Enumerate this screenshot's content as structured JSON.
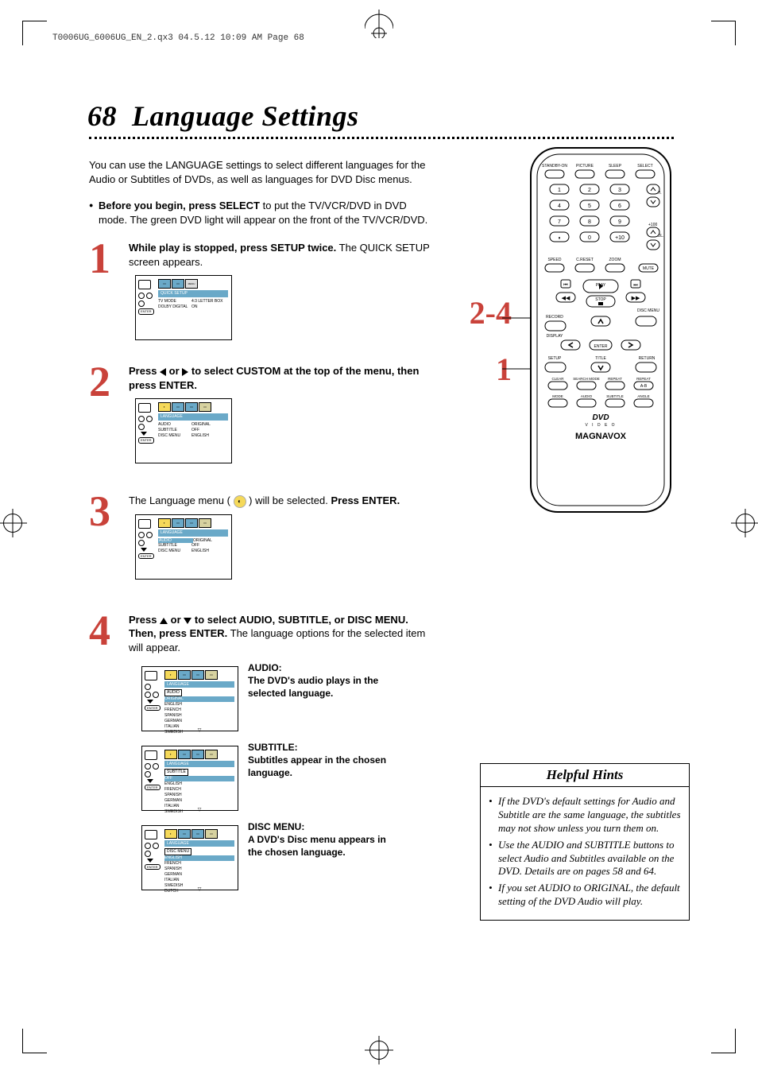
{
  "header_line": "T0006UG_6006UG_EN_2.qx3  04.5.12  10:09 AM  Page 68",
  "title_num": "68",
  "title_text": "Language Settings",
  "intro": "You can use the LANGUAGE settings to select different languages for the Audio or Subtitles of DVDs, as well as languages for DVD Disc menus.",
  "before_bold": "Before you begin, press SELECT",
  "before_rest": " to put the TV/VCR/DVD in DVD mode.  The green DVD light will appear on the front of the TV/VCR/DVD.",
  "step1_num": "1",
  "step1_bold": "While play is stopped, press SETUP twice.",
  "step1_rest": " The QUICK SETUP screen appears.",
  "step2_num": "2",
  "step2_bold": "Press ◀ or ▶ to select CUSTOM at the top of the menu, then press ENTER.",
  "step3_num": "3",
  "step3_a": "The Language menu ( ",
  "step3_b": " ) will be selected. ",
  "step3_bold": "Press ENTER.",
  "step4_num": "4",
  "step4_bold": "Press ▲ or ▼ to select AUDIO, SUBTITLE, or DISC MENU. Then, press ENTER.",
  "step4_rest": " The language options for the selected item will appear.",
  "audio_head": "AUDIO:",
  "audio_body": "The DVD's audio plays in the selected language.",
  "sub_head": "SUBTITLE:",
  "sub_body": "Subtitles appear in the chosen language.",
  "disc_head": "DISC MENU:",
  "disc_body": "A DVD's Disc menu appears in the chosen language.",
  "callout_24": "2-4",
  "callout_1": "1",
  "hints_title": "Helpful Hints",
  "hint1": "If the DVD's default settings for Audio and Subtitle are the same language, the subtitles may not show unless you turn them on.",
  "hint2": "Use the AUDIO and SUBTITLE buttons to select Audio and Subtitles available on the DVD. Details are on pages 58 and 64.",
  "hint3": "If you set AUDIO to ORIGINAL, the default setting of the DVD Audio will play.",
  "osd1_banner": "QUICK SETUP",
  "osd1_r1a": "TV MODE",
  "osd1_r1b": "4:3 LETTER BOX",
  "osd1_r2a": "DOLBY DIGITAL",
  "osd1_r2b": "ON",
  "osd_lang_banner": "LANGUAGE",
  "osd2_r1a": "AUDIO",
  "osd2_r1b": "ORIGINAL",
  "osd2_r2a": "SUBTITLE",
  "osd2_r2b": "OFF",
  "osd2_r3a": "DISC MENU",
  "osd2_r3b": "ENGLISH",
  "osd4a_head": "AUDIO",
  "osd4a_items": [
    "ORIGINAL",
    "ENGLISH",
    "FRENCH",
    "SPANISH",
    "GERMAN",
    "ITALIAN",
    "SWEDISH"
  ],
  "osd4b_head": "SUBTITLE",
  "osd4b_items": [
    "OFF",
    "ENGLISH",
    "FRENCH",
    "SPANISH",
    "GERMAN",
    "ITALIAN",
    "SWEDISH"
  ],
  "osd4c_head": "DISC MENU",
  "osd4c_items": [
    "ENGLISH",
    "FRENCH",
    "SPANISH",
    "GERMAN",
    "ITALIAN",
    "SWEDISH",
    "DUTCH"
  ],
  "enter_label": "ENTER",
  "remote": {
    "row1": [
      "STANDBY-ON",
      "PICTURE",
      "SLEEP",
      "SELECT"
    ],
    "numpad": [
      "1",
      "2",
      "3",
      "4",
      "5",
      "6",
      "7",
      "8",
      "9",
      "",
      "0",
      "+10"
    ],
    "ch": "CH.",
    "vol": "VOL.",
    "plus100": "+100",
    "row3": [
      "SPEED",
      "C.RESET",
      "ZOOM",
      "MUTE"
    ],
    "play": "PLAY",
    "stop": "STOP",
    "rew": "◀◀",
    "ff": "▶▶",
    "prev": "⏮",
    "next": "⏭",
    "record": "RECORD",
    "discmenu": "DISC MENU",
    "display": "DISPLAY",
    "enter": "ENTER",
    "setup": "SETUP",
    "title": "TITLE",
    "return": "RETURN",
    "row_bottom1": [
      "CLEAR",
      "SEARCH MODE",
      "REPEAT",
      "REPEAT A-B"
    ],
    "row_bottom2": [
      "MODE",
      "AUDIO",
      "SUBTITLE",
      "ANGLE"
    ],
    "brand_dvd": "DVD",
    "brand_video": "V I D E O",
    "brand": "MAGNAVOX"
  }
}
